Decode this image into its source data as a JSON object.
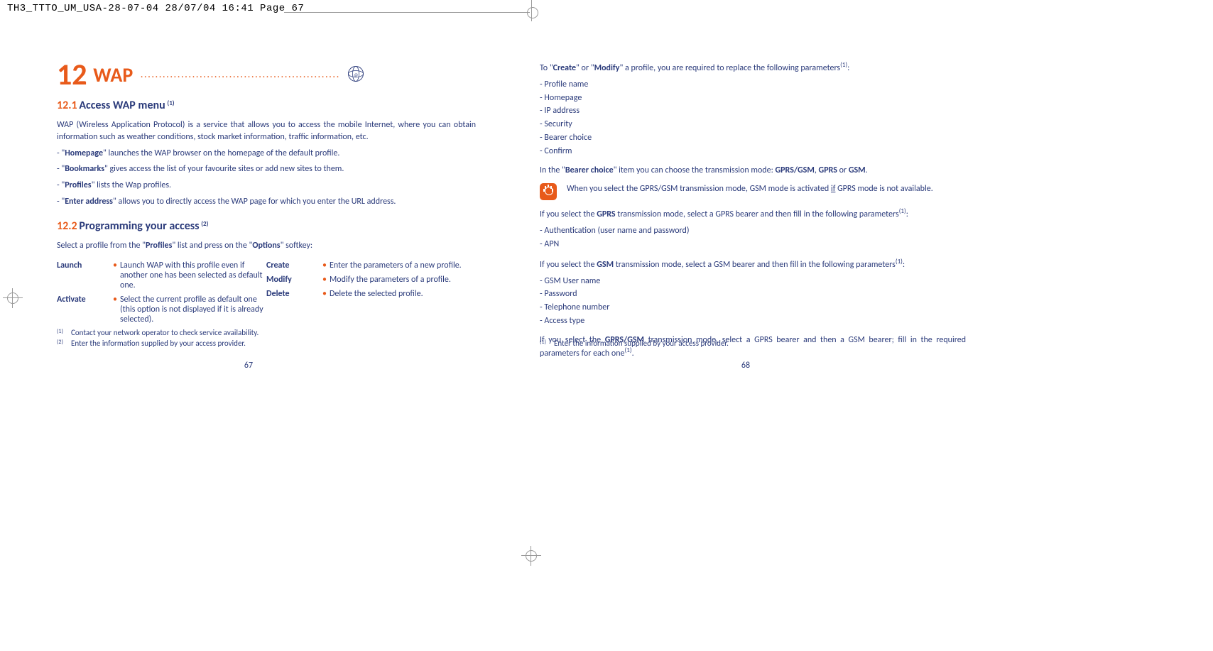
{
  "header": {
    "raw": "TH3_TTTO_UM_USA-28-07-04  28/07/04  16:41  Page 67"
  },
  "leftPage": {
    "chapterNumber": "12",
    "chapterTitle": "WAP",
    "dots": "......................................................",
    "section1": {
      "num": "12.1",
      "title": "Access WAP menu",
      "sup": "(1)"
    },
    "intro": "WAP (Wireless Application Protocol) is a service that allows you to access the mobile Internet, where you can obtain information such as weather conditions, stock market information, traffic information, etc.",
    "b1_pre": "- \"",
    "b1_bold": "Homepage",
    "b1_post": "\" launches the WAP browser on the homepage of the default profile.",
    "b2_pre": "- \"",
    "b2_bold": "Bookmarks",
    "b2_post": "\" gives access the list of your favourite sites or add new sites to them.",
    "b3_pre": "- \"",
    "b3_bold": "Profiles",
    "b3_post": "\" lists the Wap profiles.",
    "b4_pre": "- \"",
    "b4_bold": "Enter address",
    "b4_post": "\" allows you to directly access the WAP page for which you enter the URL address.",
    "section2": {
      "num": "12.2",
      "title": "Programming your access",
      "sup": "(2)"
    },
    "selline_pre": "Select a profile from the \"",
    "selline_b1": "Profiles",
    "selline_mid": "\" list and press on the \"",
    "selline_b2": "Options",
    "selline_post": "\" softkey:",
    "opts": {
      "launch": {
        "label": "Launch",
        "desc": "Launch WAP with this profile even if another one has been selected as default one."
      },
      "activate": {
        "label": "Activate",
        "desc": "Select the current profile as default one (this option is not displayed if it is already selected)."
      },
      "create": {
        "label": "Create",
        "desc": "Enter the parameters of a new profile."
      },
      "modify": {
        "label": "Modify",
        "desc": "Modify the parameters of a profile."
      },
      "delete": {
        "label": "Delete",
        "desc": "Delete the selected profile."
      }
    },
    "fn1": {
      "mark": "(1)",
      "text": "Contact your network operator to check service availability."
    },
    "fn2": {
      "mark": "(2)",
      "text": "Enter the information supplied by your access provider."
    },
    "pageNum": "67"
  },
  "rightPage": {
    "toCreate_pre": "To \"",
    "toCreate_b1": "Create",
    "toCreate_mid": "\" or \"",
    "toCreate_b2": "Modify",
    "toCreate_post": "\" a profile, you are required to replace the following parameters",
    "toCreate_sup": "(1)",
    "toCreate_end": ":",
    "params1": [
      "Profile name",
      "Homepage",
      "IP address",
      "Security",
      "Bearer choice",
      "Confirm"
    ],
    "bearer_pre": "In the \"",
    "bearer_b": "Bearer choice",
    "bearer_mid": "\" item you can choose the transmission mode: ",
    "bearer_b1": "GPRS/GSM",
    "bearer_c1": ", ",
    "bearer_b2": "GPRS",
    "bearer_c2": " or ",
    "bearer_b3": "GSM",
    "bearer_end": ".",
    "tip_pre": "When you select the GPRS/GSM transmission mode, GSM mode is activated ",
    "tip_u": "if",
    "tip_post": " GPRS mode is not available.",
    "gprs_pre": "If you select the ",
    "gprs_b": "GPRS",
    "gprs_post": " transmission mode, select a GPRS bearer and then fill in the following parameters",
    "gprs_sup": "(1)",
    "gprs_end": ":",
    "params2": [
      "Authentication (user name and password)",
      "APN"
    ],
    "gsm_pre": "If you select the ",
    "gsm_b": "GSM",
    "gsm_post": " transmission mode, select a GSM bearer and then fill in the following parameters",
    "gsm_sup": "(1)",
    "gsm_end": ":",
    "params3": [
      "GSM User name",
      "Password",
      "Telephone number",
      "Access type"
    ],
    "ggsm_pre": "If you select the ",
    "ggsm_b": "GPRS/GSM",
    "ggsm_post": " transmission mode, select a GPRS bearer and then a GSM bearer; fill in the required parameters for each one",
    "ggsm_sup": "(1)",
    "ggsm_end": ".",
    "fn1": {
      "mark": "(1)",
      "text": "Enter the information supplied by your access provider."
    },
    "pageNum": "68"
  }
}
